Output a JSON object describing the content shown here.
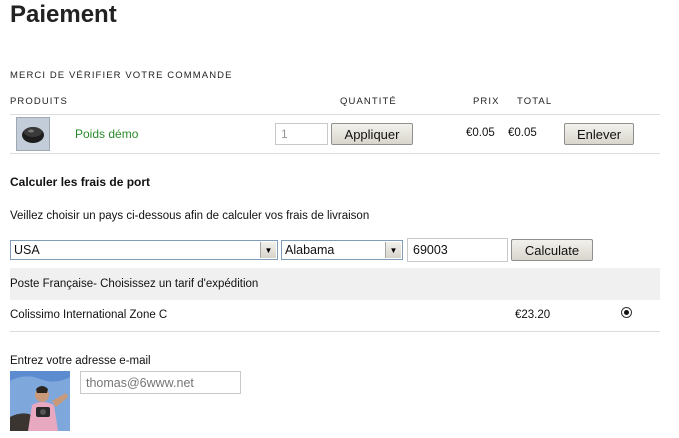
{
  "page": {
    "title": "Paiement"
  },
  "order": {
    "heading": "MERCI DE VÉRIFIER VOTRE COMMANDE",
    "columns": {
      "products": "PRODUITS",
      "quantity": "QUANTITÉ",
      "price": "PRIX",
      "total": "TOTAL"
    },
    "item": {
      "name": "Poids démo",
      "quantity": "1",
      "apply_label": "Appliquer",
      "price": "€0.05",
      "total": "€0.05",
      "remove_label": "Enlever"
    }
  },
  "shipping": {
    "heading": "Calculer les frais de port",
    "instruction": "Veillez choisir un pays ci-dessous afin de calculer vos frais de livraison",
    "country": "USA",
    "state": "Alabama",
    "zip": "69003",
    "calculate_label": "Calculate",
    "carrier_note": "Poste Française- Choisissez un tarif d'expédition",
    "option": {
      "name": "Colissimo International Zone C",
      "price": "€23.20",
      "selected": true
    }
  },
  "email": {
    "label": "Entrez votre adresse e-mail",
    "placeholder": "thomas@6www.net"
  }
}
